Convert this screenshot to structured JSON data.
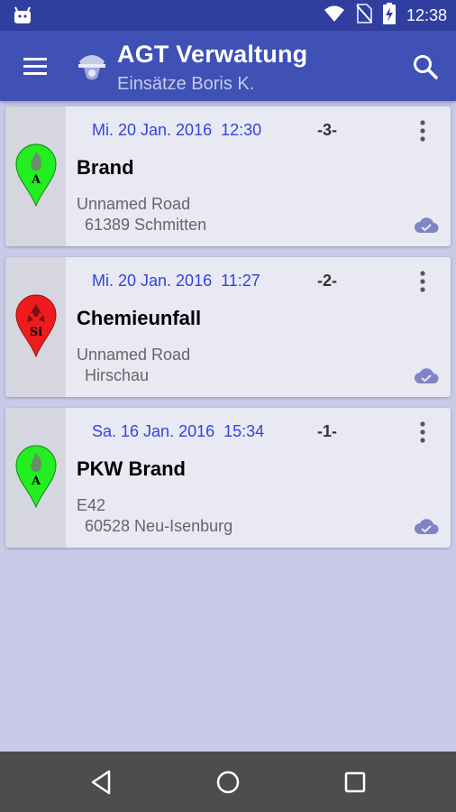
{
  "status_bar": {
    "time": "12:38",
    "icons": [
      "android-icon",
      "wifi-icon",
      "no-sim-icon",
      "battery-charging-icon"
    ]
  },
  "app_bar": {
    "title": "AGT Verwaltung",
    "subtitle": "Einsätze Boris K.",
    "icons": [
      "menu-icon",
      "helmet-logo-icon",
      "search-icon"
    ]
  },
  "deployments": [
    {
      "date": "Mi. 20 Jan. 2016  12:30",
      "number": "-3-",
      "title": "Brand",
      "street": "Unnamed Road",
      "city": "61389 Schmitten",
      "pin_letter": "A",
      "pin_color": "#22ee22",
      "pin_icon": "fire-pin-icon"
    },
    {
      "date": "Mi. 20 Jan. 2016  11:27",
      "number": "-2-",
      "title": "Chemieunfall",
      "street": "Unnamed Road",
      "city": "Hirschau",
      "pin_letter": "Si",
      "pin_color": "#ee1c1c",
      "pin_icon": "hazard-pin-icon"
    },
    {
      "date": "Sa. 16 Jan. 2016  15:34",
      "number": "-1-",
      "title": "PKW Brand",
      "street": "E42",
      "city": "60528 Neu-Isenburg",
      "pin_letter": "A",
      "pin_color": "#22ee22",
      "pin_icon": "fire-pin-icon"
    }
  ],
  "colors": {
    "primary": "#3f51b5",
    "primary_dark": "#303f9f",
    "background": "#c8cae8",
    "date_text": "#3146d6",
    "cloud_icon": "#7e84c4"
  },
  "nav_bar": {
    "icons": [
      "back-icon",
      "home-icon",
      "recents-icon"
    ]
  }
}
